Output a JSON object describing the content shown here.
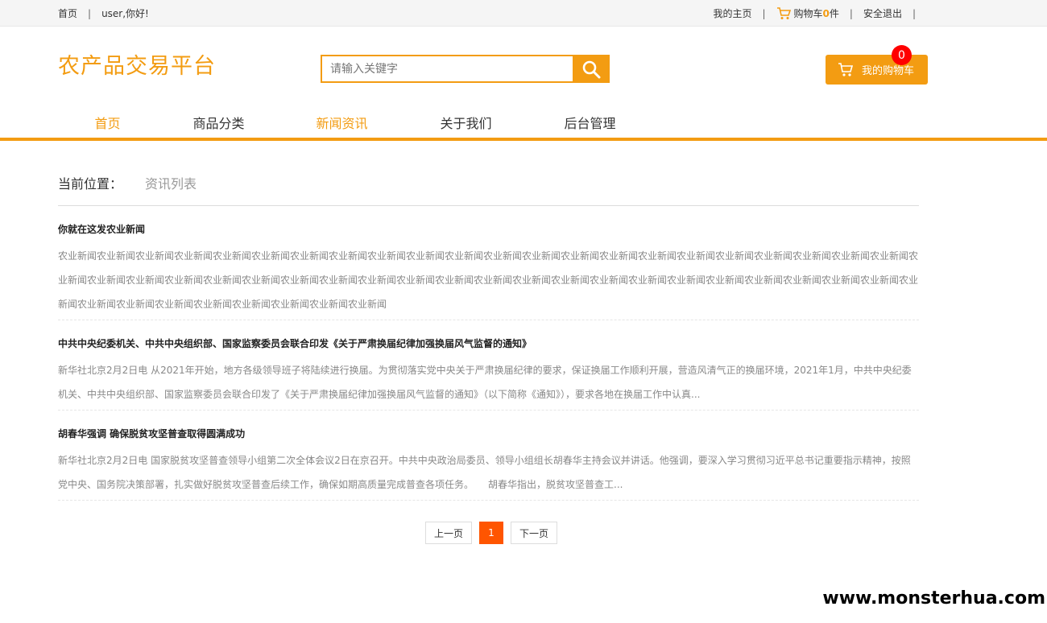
{
  "topbar": {
    "home": "首页",
    "greeting": "user,你好!",
    "my_home": "我的主页",
    "cart_label": "购物车",
    "cart_count": "0",
    "cart_unit": "件",
    "logout": "安全退出",
    "sep": "|"
  },
  "header": {
    "logo": "农产品交易平台",
    "search_placeholder": "请输入关键字",
    "cart_button": "我的购物车",
    "cart_badge": "0"
  },
  "nav": {
    "items": [
      "首页",
      "商品分类",
      "新闻资讯",
      "关于我们",
      "后台管理"
    ]
  },
  "breadcrumb": {
    "label": "当前位置：",
    "current": "资讯列表"
  },
  "news": [
    {
      "title": "你就在这发农业新闻",
      "desc": "农业新闻农业新闻农业新闻农业新闻农业新闻农业新闻农业新闻农业新闻农业新闻农业新闻农业新闻农业新闻农业新闻农业新闻农业新闻农业新闻农业新闻农业新闻农业新闻农业新闻农业新闻农业新闻农业新闻农业新闻农业新闻农业新闻农业新闻农业新闻农业新闻农业新闻农业新闻农业新闻农业新闻农业新闻农业新闻农业新闻农业新闻农业新闻农业新闻农业新闻农业新闻农业新闻农业新闻农业新闻农业新闻农业新闻农业新闻农业新闻农业新闻农业新闻农业新闻农业新闻农业新闻"
    },
    {
      "title": "中共中央纪委机关、中共中央组织部、国家监察委员会联合印发《关于严肃换届纪律加强换届风气监督的通知》",
      "desc": "新华社北京2月2日电 从2021年开始，地方各级领导班子将陆续进行换届。为贯彻落实党中央关于严肃换届纪律的要求，保证换届工作顺利开展，营造风清气正的换届环境，2021年1月，中共中央纪委机关、中共中央组织部、国家监察委员会联合印发了《关于严肃换届纪律加强换届风气监督的通知》（以下简称《通知》），要求各地在换届工作中认真..."
    },
    {
      "title": "胡春华强调 确保脱贫攻坚普查取得圆满成功",
      "desc": "新华社北京2月2日电 国家脱贫攻坚普查领导小组第二次全体会议2日在京召开。中共中央政治局委员、领导小组组长胡春华主持会议并讲话。他强调，要深入学习贯彻习近平总书记重要指示精神，按照党中央、国务院决策部署，扎实做好脱贫攻坚普查后续工作，确保如期高质量完成普查各项任务。　　胡春华指出，脱贫攻坚普查工..."
    }
  ],
  "pager": {
    "prev": "上一页",
    "current": "1",
    "next": "下一页"
  },
  "watermark": "www.monsterhua.com",
  "colors": {
    "accent": "#f39c12",
    "badge": "#ff0000",
    "page_active": "#ff5500"
  }
}
